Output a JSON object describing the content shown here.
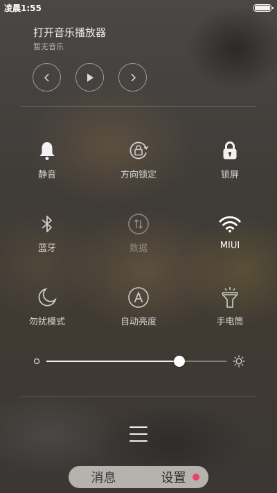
{
  "status_bar": {
    "time": "凌晨1:55",
    "battery_level_percent": 100
  },
  "music": {
    "title": "打开音乐播放器",
    "subtitle": "暂无音乐",
    "controls": [
      "previous-icon",
      "play-icon",
      "next-icon"
    ]
  },
  "toggles": [
    {
      "label": "静音",
      "icon": "bell-icon",
      "state": "off"
    },
    {
      "label": "方向锁定",
      "icon": "rotation-lock-icon",
      "state": "off"
    },
    {
      "label": "锁屏",
      "icon": "lock-icon",
      "state": "off"
    },
    {
      "label": "蓝牙",
      "icon": "bluetooth-icon",
      "state": "off"
    },
    {
      "label": "数据",
      "icon": "mobile-data-icon",
      "state": "disabled"
    },
    {
      "label": "MIUI",
      "icon": "wifi-icon",
      "state": "on"
    },
    {
      "label": "勿扰模式",
      "icon": "moon-icon",
      "state": "off"
    },
    {
      "label": "自动亮度",
      "icon": "auto-brightness-icon",
      "state": "off"
    },
    {
      "label": "手电筒",
      "icon": "flashlight-icon",
      "state": "off"
    }
  ],
  "brightness": {
    "level_fraction": 0.74,
    "low_icon": "brightness-low-icon",
    "high_icon": "brightness-high-icon"
  },
  "bottom_tabs": {
    "messages": "消息",
    "settings": "设置",
    "active": "settings",
    "badge_color": "#ef3f6b"
  },
  "colors": {
    "accent_white": "#ffffff",
    "text_dim": "#8e8a86"
  }
}
